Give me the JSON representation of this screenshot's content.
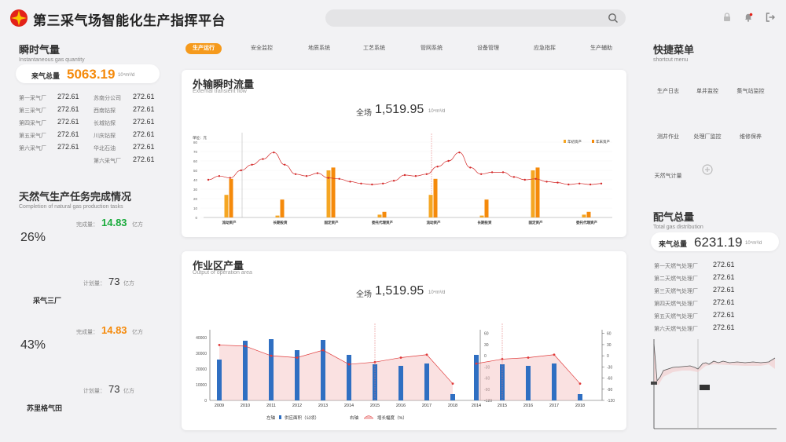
{
  "app": {
    "title": "第三采气场智能化生产指挥平台"
  },
  "header": {
    "icons": [
      "lock-icon",
      "bell-icon",
      "exit-icon"
    ]
  },
  "instant": {
    "title": "瞬时气量",
    "subtitle": "Instantaneous gas quantity",
    "total_label": "来气总量",
    "total_value": "5063.19",
    "total_unit": "10⁴m³/d",
    "left_items": [
      {
        "name": "第一采气厂",
        "value": "272.61"
      },
      {
        "name": "第三采气厂",
        "value": "272.61"
      },
      {
        "name": "第四采气厂",
        "value": "272.61"
      },
      {
        "name": "第五采气厂",
        "value": "272.61"
      },
      {
        "name": "第六采气厂",
        "value": "272.61"
      }
    ],
    "right_items": [
      {
        "name": "苏南分公司",
        "value": "272.61"
      },
      {
        "name": "西南钻探",
        "value": "272.61"
      },
      {
        "name": "长城钻探",
        "value": "272.61"
      },
      {
        "name": "川庆钻探",
        "value": "272.61"
      },
      {
        "name": "华北石油",
        "value": "272.61"
      },
      {
        "name": "第六采气厂",
        "value": "272.61"
      }
    ]
  },
  "tasks": {
    "title": "天然气生产任务完成情况",
    "subtitle": "Completion of natural gas production tasks",
    "items": [
      {
        "name": "采气三厂",
        "percent": 26,
        "pct_sign": "%",
        "done_label": "完成量：",
        "done_value": "14.83",
        "done_unit": "亿方",
        "plan_label": "计划量：",
        "plan_value": "73",
        "plan_unit": "亿方",
        "color": "#1aab3c"
      },
      {
        "name": "苏里格气田",
        "percent": 43,
        "pct_sign": "%",
        "done_label": "完成量：",
        "done_value": "14.83",
        "done_unit": "亿方",
        "plan_label": "计划量：",
        "plan_value": "73",
        "plan_unit": "亿方",
        "color": "#f58a0b"
      }
    ]
  },
  "tabs": [
    {
      "label": "生产运行",
      "active": true
    },
    {
      "label": "安全监控",
      "active": false
    },
    {
      "label": "地质系统",
      "active": false
    },
    {
      "label": "工艺系统",
      "active": false
    },
    {
      "label": "管网系统",
      "active": false
    },
    {
      "label": "设备管理",
      "active": false
    },
    {
      "label": "应急指挥",
      "active": false
    },
    {
      "label": "生产辅助",
      "active": false
    }
  ],
  "panel1": {
    "title": "外输瞬时流量",
    "subtitle": "External transient flow",
    "total_label": "全场",
    "total_value": "1,519.95",
    "total_unit": "10⁴m³/d"
  },
  "panel2": {
    "title": "作业区产量",
    "subtitle": "Output of operation area",
    "total_label": "全场",
    "total_value": "1,519.95",
    "total_unit": "10⁴m³/d"
  },
  "chart_data": [
    {
      "type": "bar",
      "unit_label": "单位：元",
      "categories": [
        "流动资产",
        "长期投资",
        "固定资产",
        "委托代理资产",
        "流动资产",
        "长期投资",
        "固定资产",
        "委托代理资产"
      ],
      "series": [
        {
          "name": "年初资产",
          "color": "#f5a623",
          "values": [
            24,
            2,
            50,
            3,
            24,
            2,
            50,
            3
          ]
        },
        {
          "name": "年末资产",
          "color": "#f58a0b",
          "values": [
            41,
            19,
            53,
            6,
            41,
            19,
            53,
            6
          ]
        }
      ],
      "line_values": [
        40,
        44,
        42,
        50,
        56,
        62,
        69,
        56,
        46,
        44,
        47,
        42,
        41,
        38,
        36,
        35,
        36,
        39,
        45,
        44,
        46,
        54,
        60,
        69,
        53,
        46,
        48,
        48,
        43,
        40,
        41,
        38,
        37,
        35,
        36,
        35,
        36
      ],
      "yticks": [
        0,
        10,
        20,
        30,
        40,
        50,
        60,
        70,
        80
      ],
      "ylim": [
        0,
        80
      ]
    },
    {
      "type": "bar",
      "categories": [
        "2009",
        "2010",
        "2011",
        "2012",
        "2013",
        "2014",
        "2015",
        "2016",
        "2017",
        "2018",
        "2014",
        "2015",
        "2016",
        "2017",
        "2018"
      ],
      "series": [
        {
          "name": "供应面积（公顷）",
          "color": "#2f6fc2",
          "values": [
            26000,
            38000,
            39000,
            32000,
            38500,
            29000,
            23000,
            22000,
            23500,
            4000,
            29000,
            23000,
            22000,
            23500,
            4000
          ]
        }
      ],
      "line": {
        "name": "增长幅度（%）",
        "color": "#e03a3a",
        "values": [
          29,
          26,
          0,
          -5,
          15,
          -23,
          -17,
          -5,
          3,
          -75,
          -21,
          -9,
          -5,
          3,
          -75
        ]
      },
      "left_axis_label": "左轴",
      "right_axis_label": "右轴",
      "left_ticks": [
        0,
        10000,
        20000,
        30000,
        40000
      ],
      "right_ticks": [
        60,
        30,
        0,
        -30,
        -60,
        -90,
        -120
      ],
      "ylim_left": [
        0,
        45000
      ],
      "ylim_right": [
        -120,
        70
      ]
    }
  ],
  "shortcut": {
    "title": "快捷菜单",
    "subtitle": "shortcut menu",
    "items": [
      {
        "label": "生产日志",
        "icon": "calendar-icon",
        "color": "#f58a0b"
      },
      {
        "label": "单井监控",
        "icon": "camera-icon",
        "color": "#2f6fc2"
      },
      {
        "label": "集气站监控",
        "icon": "bar-chart-icon",
        "color": "#1aab3c"
      },
      {
        "label": "测井作业",
        "icon": "document-icon",
        "color": "#e02020"
      },
      {
        "label": "处理厂监控",
        "icon": "building-icon",
        "color": "#1aab3c"
      },
      {
        "label": "维修保养",
        "icon": "wrench-doc-icon",
        "color": "#f58a0b"
      },
      {
        "label": "天然气计量",
        "icon": "calculator-icon",
        "color": "#2f8fe0"
      }
    ]
  },
  "distribution": {
    "title": "配气总量",
    "subtitle": "Total gas distribution",
    "total_label": "来气总量",
    "total_value": "6231.19",
    "total_unit": "10⁴m³/d",
    "items": [
      {
        "name": "第一天燃气处理厂",
        "value": "272.61"
      },
      {
        "name": "第二天燃气处理厂",
        "value": "272.61"
      },
      {
        "name": "第三天燃气处理厂",
        "value": "272.61"
      },
      {
        "name": "第四天燃气处理厂",
        "value": "272.61"
      },
      {
        "name": "第五天燃气处理厂",
        "value": "272.61"
      },
      {
        "name": "第六天燃气处理厂",
        "value": "272.61"
      }
    ]
  }
}
